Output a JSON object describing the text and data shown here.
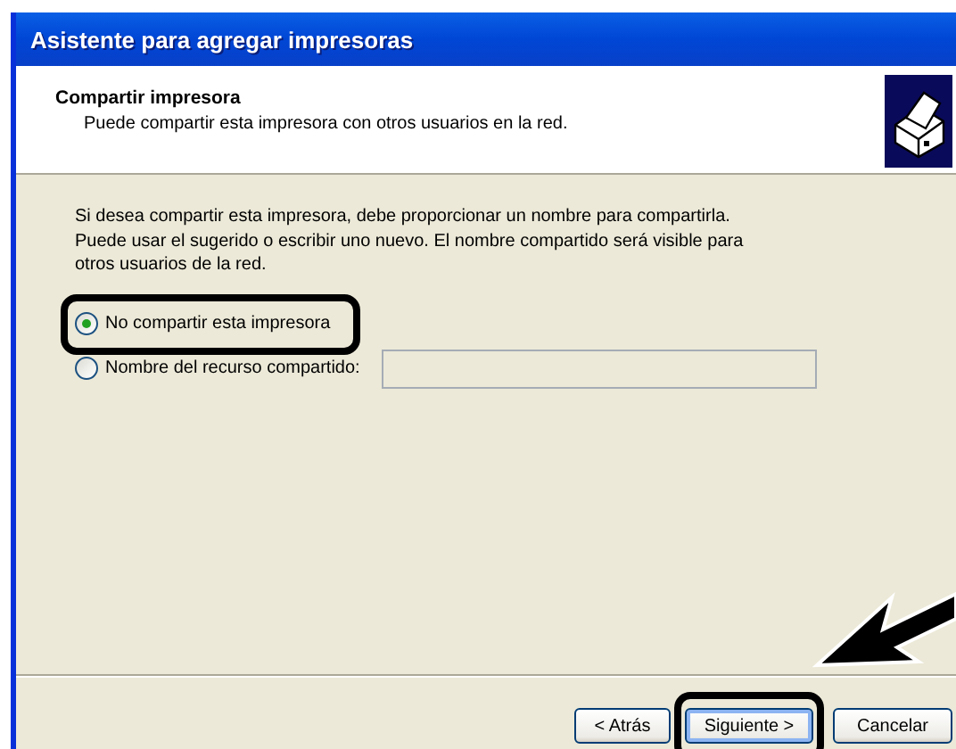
{
  "window": {
    "title": "Asistente para agregar impresoras"
  },
  "header": {
    "title": "Compartir impresora",
    "subtitle": "Puede compartir esta impresora con otros usuarios en la red."
  },
  "description": "Si desea compartir esta impresora, debe proporcionar un nombre para compartirla. Puede usar el sugerido o escribir uno nuevo. El nombre compartido será visible para otros usuarios de la red.",
  "options": [
    {
      "label": "No compartir esta impresora",
      "selected": true,
      "kind": "plain"
    },
    {
      "label": "Nombre del recurso compartido:",
      "selected": false,
      "kind": "field"
    }
  ],
  "buttons": [
    {
      "label": "< Atrás",
      "highlighted": false
    },
    {
      "label": "Siguiente >",
      "highlighted": true
    },
    {
      "label": "Cancelar",
      "highlighted": false
    }
  ]
}
